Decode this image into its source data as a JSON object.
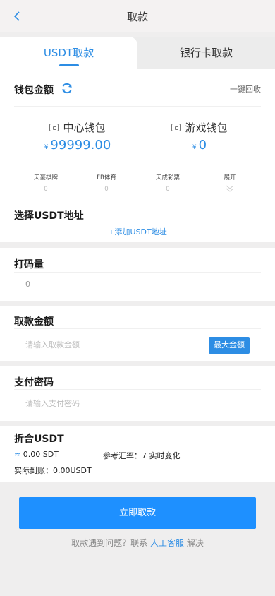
{
  "navbar": {
    "title": "取款"
  },
  "tabs": [
    {
      "label": "USDT取款",
      "active": true
    },
    {
      "label": "银行卡取款",
      "active": false
    }
  ],
  "wallet": {
    "title": "钱包金额",
    "recycle": "一键回收",
    "center": {
      "name": "中心钱包",
      "currency": "¥",
      "amount": "99999.00"
    },
    "game": {
      "name": "游戏钱包",
      "currency": "¥",
      "amount": "0"
    },
    "venues": [
      {
        "name": "天豪棋牌",
        "value": "0"
      },
      {
        "name": "FB体育",
        "value": "0"
      },
      {
        "name": "天成彩票",
        "value": "0"
      }
    ],
    "expand": "展开"
  },
  "address": {
    "title": "选择USDT地址",
    "add": "+添加USDT地址"
  },
  "betting": {
    "title": "打码量",
    "value": "0"
  },
  "amount": {
    "title": "取款金额",
    "placeholder": "请输入取款金额",
    "max": "最大金额"
  },
  "password": {
    "title": "支付密码",
    "placeholder": "请输入支付密码"
  },
  "convert": {
    "title": "折合USDT",
    "approx": "≈",
    "value": "0.00 SDT",
    "rate": "参考汇率：7 实时变化",
    "actual": "实际到账：0.00USDT"
  },
  "submit": "立即取款",
  "help": {
    "prefix": "取款遇到问题？联系",
    "link": "人工客服",
    "suffix": "解决"
  },
  "colors": {
    "accent": "#2d8de4",
    "button": "#1e90ff"
  }
}
